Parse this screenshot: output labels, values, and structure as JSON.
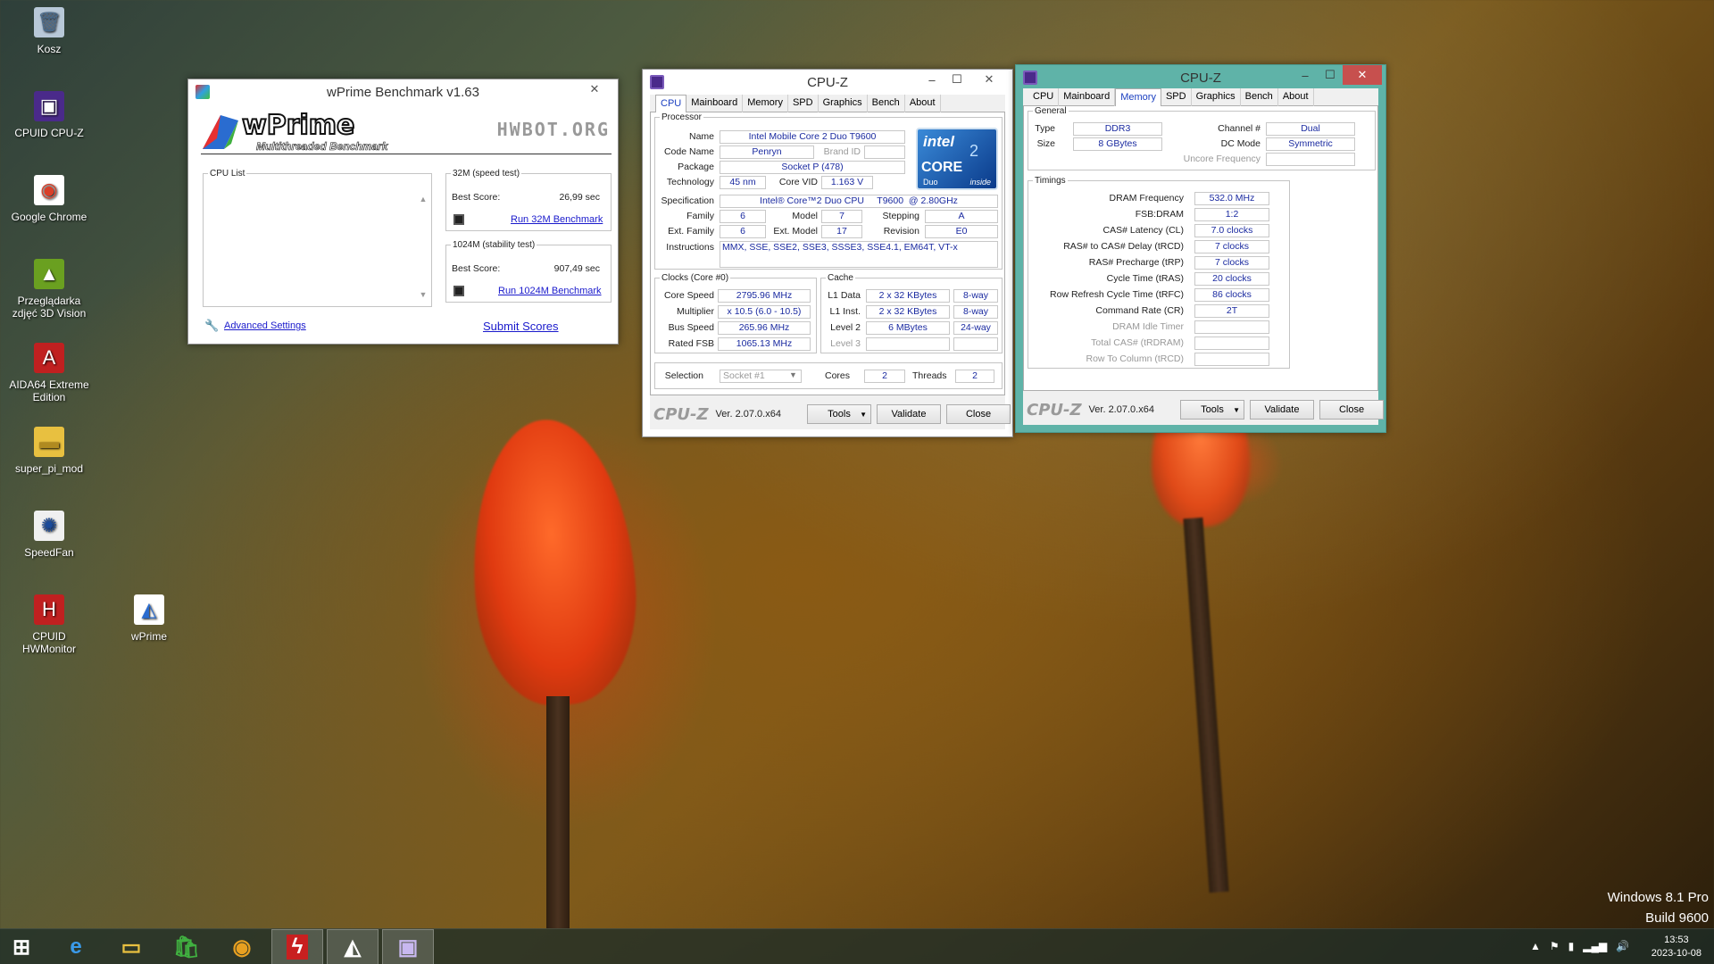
{
  "desktop": {
    "icons": [
      {
        "label": "Kosz",
        "icon": "recycle-bin-icon"
      },
      {
        "label": "CPUID CPU-Z",
        "icon": "cpuz-icon"
      },
      {
        "label": "Google Chrome",
        "icon": "chrome-icon"
      },
      {
        "label": "Przeglądarka zdjęć 3D Vision",
        "icon": "3d-vision-icon"
      },
      {
        "label": "AIDA64 Extreme Edition",
        "icon": "aida64-icon"
      },
      {
        "label": "super_pi_mod",
        "icon": "folder-icon"
      },
      {
        "label": "SpeedFan",
        "icon": "speedfan-icon"
      },
      {
        "label": "CPUID HWMonitor",
        "icon": "hwmonitor-icon"
      },
      {
        "label": "wPrime",
        "icon": "wprime-icon"
      }
    ],
    "watermark": {
      "line1": "Windows 8.1 Pro",
      "line2": "Build 9600"
    }
  },
  "wprime": {
    "title": "wPrime Benchmark v1.63",
    "logo": "wPrime",
    "subtitle": "Multithreaded Benchmark",
    "hwbot": "HWBOT.ORG",
    "cpu_list_label": "CPU List",
    "test32": {
      "legend": "32M (speed test)",
      "best_label": "Best Score:",
      "best_value": "26,99 sec",
      "run": "Run 32M Benchmark"
    },
    "test1024": {
      "legend": "1024M (stability test)",
      "best_label": "Best Score:",
      "best_value": "907,49 sec",
      "run": "Run 1024M Benchmark"
    },
    "advanced": "Advanced Settings",
    "submit": "Submit Scores"
  },
  "cpuz1": {
    "title": "CPU-Z",
    "tabs": [
      "CPU",
      "Mainboard",
      "Memory",
      "SPD",
      "Graphics",
      "Bench",
      "About"
    ],
    "active_tab": "CPU",
    "processor": {
      "legend": "Processor",
      "name_label": "Name",
      "name": "Intel Mobile Core 2 Duo T9600",
      "codename_label": "Code Name",
      "codename": "Penryn",
      "brandid_label": "Brand ID",
      "package_label": "Package",
      "package": "Socket P (478)",
      "tech_label": "Technology",
      "tech": "45 nm",
      "vid_label": "Core VID",
      "vid": "1.163 V",
      "spec_label": "Specification",
      "spec": "Intel® Core™2 Duo CPU     T9600  @ 2.80GHz",
      "family_label": "Family",
      "family": "6",
      "model_label": "Model",
      "model": "7",
      "stepping_label": "Stepping",
      "stepping": "A",
      "extfamily_label": "Ext. Family",
      "extfamily": "6",
      "extmodel_label": "Ext. Model",
      "extmodel": "17",
      "revision_label": "Revision",
      "revision": "E0",
      "instr_label": "Instructions",
      "instr": "MMX, SSE, SSE2, SSE3, SSSE3, SSE4.1, EM64T, VT-x"
    },
    "badge": {
      "brand": "intel",
      "line": "CORE",
      "sub": "Duo",
      "inside": "inside",
      "num": "2"
    },
    "clocks": {
      "legend": "Clocks (Core #0)",
      "core_speed_label": "Core Speed",
      "core_speed": "2795.96 MHz",
      "multiplier_label": "Multiplier",
      "multiplier": "x 10.5 (6.0 - 10.5)",
      "bus_label": "Bus Speed",
      "bus": "265.96 MHz",
      "fsb_label": "Rated FSB",
      "fsb": "1065.13 MHz"
    },
    "cache": {
      "legend": "Cache",
      "l1d_label": "L1 Data",
      "l1d": "2 x 32 KBytes",
      "l1d_way": "8-way",
      "l1i_label": "L1 Inst.",
      "l1i": "2 x 32 KBytes",
      "l1i_way": "8-way",
      "l2_label": "Level 2",
      "l2": "6 MBytes",
      "l2_way": "24-way",
      "l3_label": "Level 3"
    },
    "selection_label": "Selection",
    "selection": "Socket #1",
    "cores_label": "Cores",
    "cores": "2",
    "threads_label": "Threads",
    "threads": "2",
    "logo": "CPU-Z",
    "version": "Ver. 2.07.0.x64",
    "tools": "Tools",
    "validate": "Validate",
    "close": "Close"
  },
  "cpuz2": {
    "title": "CPU-Z",
    "tabs": [
      "CPU",
      "Mainboard",
      "Memory",
      "SPD",
      "Graphics",
      "Bench",
      "About"
    ],
    "active_tab": "Memory",
    "general": {
      "legend": "General",
      "type_label": "Type",
      "type": "DDR3",
      "size_label": "Size",
      "size": "8 GBytes",
      "channel_label": "Channel #",
      "channel": "Dual",
      "dcmode_label": "DC Mode",
      "dcmode": "Symmetric",
      "uncore_label": "Uncore Frequency"
    },
    "timings": {
      "legend": "Timings",
      "rows": [
        {
          "label": "DRAM Frequency",
          "value": "532.0 MHz",
          "enabled": true
        },
        {
          "label": "FSB:DRAM",
          "value": "1:2",
          "enabled": true
        },
        {
          "label": "CAS# Latency (CL)",
          "value": "7.0 clocks",
          "enabled": true
        },
        {
          "label": "RAS# to CAS# Delay (tRCD)",
          "value": "7 clocks",
          "enabled": true
        },
        {
          "label": "RAS# Precharge (tRP)",
          "value": "7 clocks",
          "enabled": true
        },
        {
          "label": "Cycle Time (tRAS)",
          "value": "20 clocks",
          "enabled": true
        },
        {
          "label": "Row Refresh Cycle Time (tRFC)",
          "value": "86 clocks",
          "enabled": true
        },
        {
          "label": "Command Rate (CR)",
          "value": "2T",
          "enabled": true
        },
        {
          "label": "DRAM Idle Timer",
          "value": "",
          "enabled": false
        },
        {
          "label": "Total CAS# (tRDRAM)",
          "value": "",
          "enabled": false
        },
        {
          "label": "Row To Column (tRCD)",
          "value": "",
          "enabled": false
        }
      ]
    },
    "logo": "CPU-Z",
    "version": "Ver. 2.07.0.x64",
    "tools": "Tools",
    "validate": "Validate",
    "close": "Close"
  },
  "taskbar": {
    "items": [
      "start-icon",
      "internet-explorer-icon",
      "file-explorer-icon",
      "store-icon",
      "chrome-icon",
      "app-red-icon",
      "wprime-icon",
      "cpuz-icon"
    ],
    "clock": {
      "time": "13:53",
      "date": "2023-10-08"
    }
  },
  "colors": {
    "accent_blue": "#1a2aa0",
    "cpuz2_frame": "#5fb3a8",
    "close_red": "#c7504e"
  }
}
